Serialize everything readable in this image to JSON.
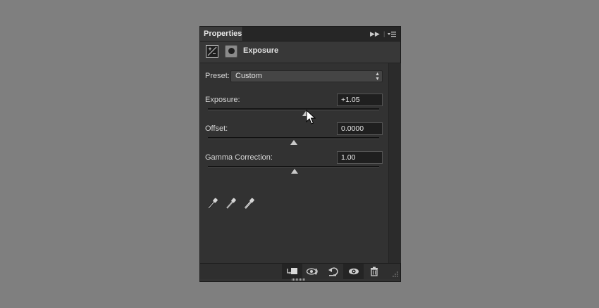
{
  "panel": {
    "tab_label": "Properties",
    "title": "Exposure",
    "icons": {
      "adjustment": "exposure-adjustment-icon",
      "mask": "layer-mask-icon",
      "collapse": "double-chevron-right-icon",
      "menu": "panel-menu-icon"
    }
  },
  "preset": {
    "label": "Preset:",
    "value": "Custom"
  },
  "controls": {
    "exposure": {
      "label": "Exposure:",
      "value": "+1.05",
      "range": [
        -20,
        20
      ],
      "numeric": 1.05
    },
    "offset": {
      "label": "Offset:",
      "value": "0.0000",
      "range": [
        -0.5,
        0.5
      ],
      "numeric": 0.0
    },
    "gamma": {
      "label": "Gamma Correction:",
      "value": "1.00",
      "range": [
        0.01,
        9.99
      ],
      "numeric": 1.0
    }
  },
  "eyedroppers": [
    "black-point-eyedropper-icon",
    "gray-point-eyedropper-icon",
    "white-point-eyedropper-icon"
  ],
  "footer": [
    "clip-to-layer-icon",
    "view-previous-state-icon",
    "reset-adjustments-icon",
    "toggle-visibility-icon",
    "delete-adjustment-icon"
  ],
  "colors": {
    "background": "#7f7f7f",
    "panel": "#323232",
    "field": "#1f1f1f"
  }
}
